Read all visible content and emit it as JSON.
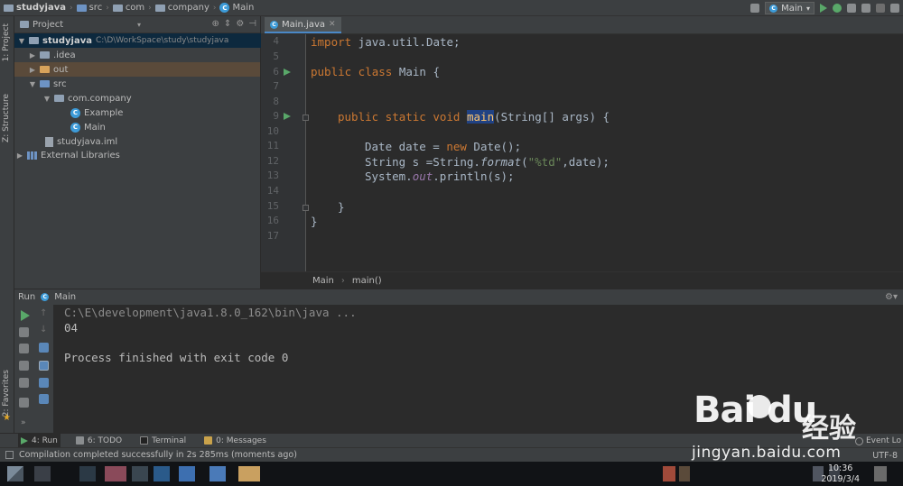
{
  "navbar": {
    "breadcrumbs": [
      "studyjava",
      "src",
      "com",
      "company",
      "Main"
    ],
    "run_config": "Main"
  },
  "left_strip": {
    "tabs": [
      "1: Project",
      "Z: Structure",
      "2: Favorites"
    ]
  },
  "project": {
    "header": "Project",
    "tree": [
      {
        "label": "studyjava",
        "path": "C:\\D\\WorkSpace\\study\\studyjava"
      },
      {
        "label": ".idea"
      },
      {
        "label": "out"
      },
      {
        "label": "src"
      },
      {
        "label": "com.company"
      },
      {
        "label": "Example"
      },
      {
        "label": "Main"
      },
      {
        "label": "studyjava.iml"
      },
      {
        "label": "External Libraries"
      }
    ]
  },
  "editor": {
    "tab": "Main.java",
    "line_numbers": [
      "4",
      "5",
      "6",
      "7",
      "8",
      "9",
      "10",
      "11",
      "12",
      "13",
      "14",
      "15",
      "16",
      "17"
    ],
    "code": {
      "l4_kw": "import",
      "l4_rest": " java.util.Date;",
      "l6_kw": "public class",
      "l6_rest": " Main {",
      "l9_kw": "public static void",
      "l9_fn": "main",
      "l9_rest": "(String[] args) {",
      "l11_a": "Date date = ",
      "l11_kw": "new",
      "l11_b": " Date();",
      "l12_a": "String s =String.",
      "l12_it": "format",
      "l12_b": "(",
      "l12_str": "\"%td\"",
      "l12_c": ",date);",
      "l13_a": "System.",
      "l13_fld": "out",
      "l13_b": ".println(s);",
      "l15": "}",
      "l16": "}"
    },
    "crumbs": [
      "Main",
      "main()"
    ]
  },
  "run": {
    "label": "Run",
    "config": "Main",
    "console": [
      "C:\\E\\development\\java1.8.0_162\\bin\\java ...",
      "04",
      "",
      "Process finished with exit code 0"
    ]
  },
  "bottom_tabs": [
    {
      "label": "4: Run"
    },
    {
      "label": "6: TODO"
    },
    {
      "label": "Terminal"
    },
    {
      "label": "0: Messages"
    }
  ],
  "event_log": "Event Lo",
  "status": {
    "message": "Compilation completed successfully in 2s 285ms (moments ago)",
    "encoding": "UTF-8"
  },
  "taskbar": {
    "time": "10:36",
    "date": "2019/3/4"
  },
  "watermark": {
    "logo": "Bai du",
    "cn": "经验",
    "url": "jingyan.baidu.com"
  }
}
